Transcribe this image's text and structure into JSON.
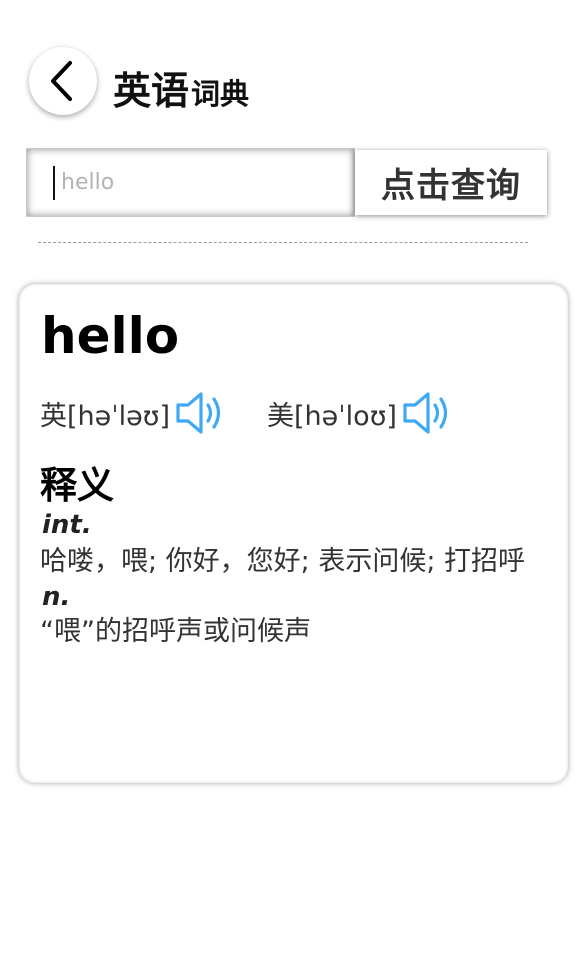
{
  "header": {
    "title_main": "英语",
    "title_sub": "词典"
  },
  "search": {
    "value": "hello",
    "button_label": "点击查询"
  },
  "result": {
    "word": "hello",
    "uk_pronunciation": "英[həˈləʊ]",
    "us_pronunciation": "美[həˈloʊ]",
    "definitions_heading": "释义",
    "definitions": [
      {
        "pos": "int.",
        "meaning": "哈喽，喂; 你好，您好; 表示问候; 打招呼"
      },
      {
        "pos": "n.",
        "meaning": "“喂”的招呼声或问候声"
      }
    ]
  },
  "colors": {
    "speaker_icon": "#3fa9f5"
  },
  "icons": {
    "back": "chevron-left-icon",
    "audio": "speaker-icon"
  }
}
